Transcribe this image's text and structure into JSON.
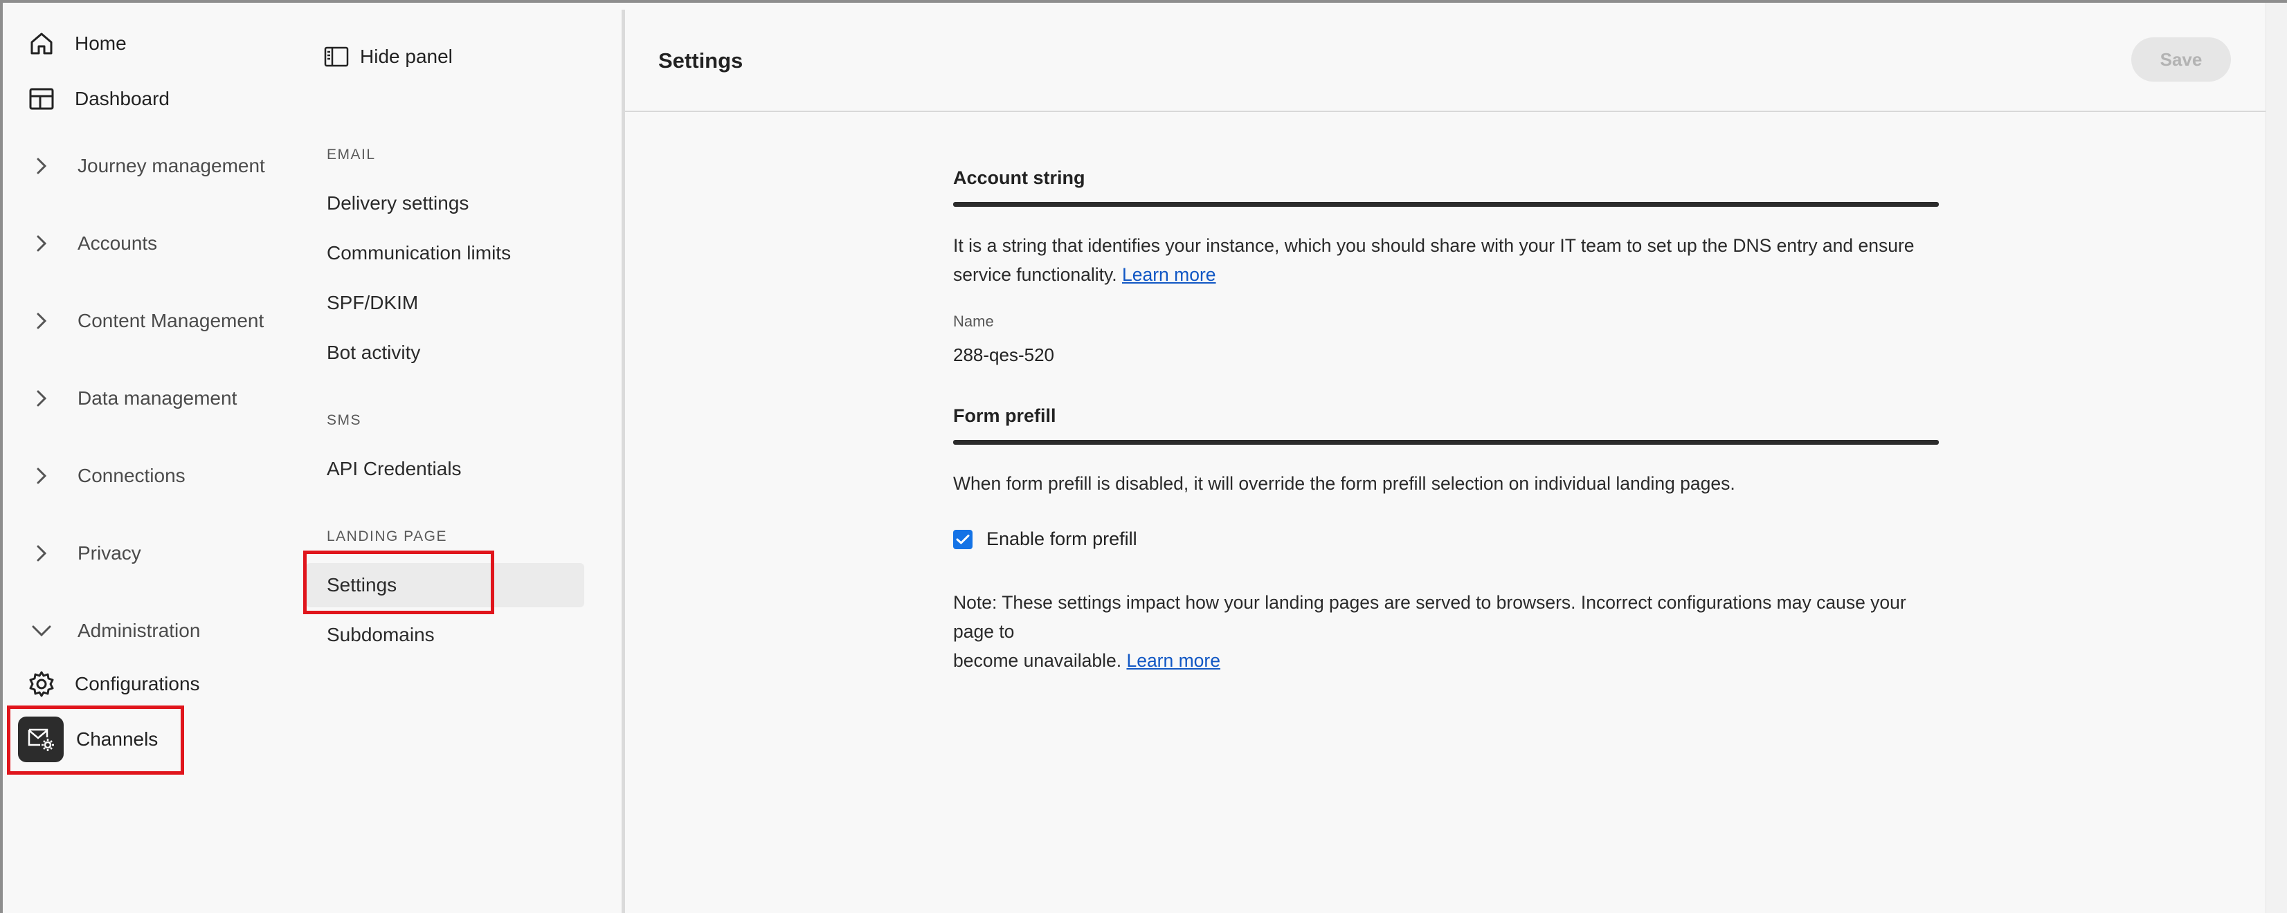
{
  "leftnav": {
    "home": {
      "label": "Home",
      "icon": "home-icon"
    },
    "dashboard": {
      "label": "Dashboard",
      "icon": "dashboard-icon"
    },
    "sections": [
      {
        "label": "Journey management",
        "expanded": false
      },
      {
        "label": "Accounts",
        "expanded": false
      },
      {
        "label": "Content Management",
        "expanded": false
      },
      {
        "label": "Data management",
        "expanded": false
      },
      {
        "label": "Connections",
        "expanded": false
      },
      {
        "label": "Privacy",
        "expanded": false
      },
      {
        "label": "Administration",
        "expanded": true
      }
    ],
    "configurations": {
      "label": "Configurations",
      "icon": "gear-icon"
    },
    "channels": {
      "label": "Channels",
      "icon": "mail-settings-icon",
      "selected": true
    }
  },
  "panel": {
    "hide_label": "Hide panel",
    "groups": [
      {
        "heading": "EMAIL",
        "items": [
          "Delivery settings",
          "Communication limits",
          "SPF/DKIM",
          "Bot activity"
        ]
      },
      {
        "heading": "SMS",
        "items": [
          "API Credentials"
        ]
      },
      {
        "heading": "LANDING PAGE",
        "items": [
          "Settings",
          "Subdomains"
        ]
      }
    ],
    "selected_item": "Settings"
  },
  "main": {
    "title": "Settings",
    "save_label": "Save",
    "account": {
      "title": "Account string",
      "description_line1": "It is a string that identifies your instance, which you should share with your IT team to set up the DNS entry and ensure",
      "description_line2": "service functionality.",
      "learn_more": "Learn more",
      "name_label": "Name",
      "name_value": "288-qes-520"
    },
    "form_prefill": {
      "title": "Form prefill",
      "description": "When form prefill is disabled, it will override the form prefill selection on individual landing pages.",
      "checkbox_label": "Enable form prefill",
      "checked": true,
      "note_line1": "Note: These settings impact how your landing pages are served to browsers. Incorrect configurations may cause your page to",
      "note_line2": "become unavailable.",
      "learn_more": "Learn more"
    }
  },
  "colors": {
    "accent": "#1473e6",
    "link": "#1157c4",
    "highlight_border": "#e0151c"
  }
}
